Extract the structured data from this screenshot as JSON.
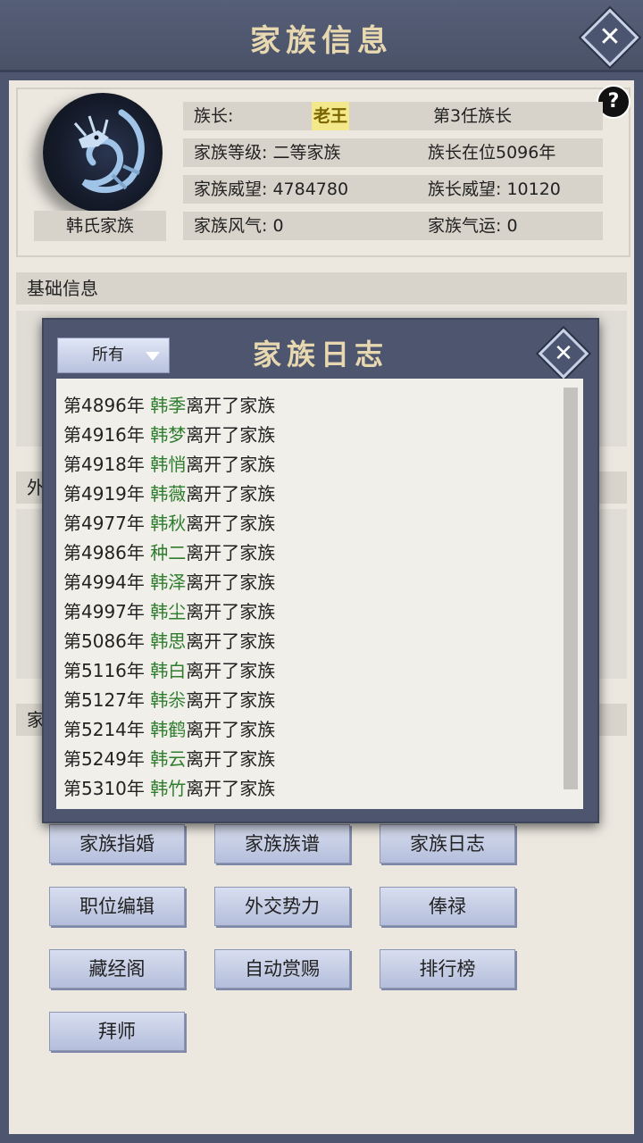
{
  "header": {
    "title": "家族信息",
    "close_label": "✕"
  },
  "clan": {
    "name": "韩氏家族",
    "help_label": "?",
    "leader_label": "族长:",
    "leader_name": "老王",
    "leader_term": "第3任族长",
    "level": "家族等级: 二等家族",
    "leader_years": "族长在位5096年",
    "prestige": "家族威望: 4784780",
    "leader_prestige": "族长威望: 10120",
    "atmosphere": "家族风气: 0",
    "fortune": "家族气运: 0"
  },
  "sections": {
    "basic": "基础信息",
    "foreign": "外",
    "family": "家"
  },
  "buttons": [
    {
      "label": "家族指婚"
    },
    {
      "label": "家族族谱"
    },
    {
      "label": "家族日志"
    },
    {
      "label": "职位编辑"
    },
    {
      "label": "外交势力"
    },
    {
      "label": "俸禄"
    },
    {
      "label": "藏经阁"
    },
    {
      "label": "自动赏赐"
    },
    {
      "label": "排行榜"
    },
    {
      "label": "拜师"
    }
  ],
  "log_modal": {
    "title": "家族日志",
    "filter_value": "所有",
    "close_label": "✕",
    "entries": [
      {
        "year": "第4896年 ",
        "name": "韩季",
        "action": "离开了家族"
      },
      {
        "year": "第4916年 ",
        "name": "韩梦",
        "action": "离开了家族"
      },
      {
        "year": "第4918年 ",
        "name": "韩悄",
        "action": "离开了家族"
      },
      {
        "year": "第4919年 ",
        "name": "韩薇",
        "action": "离开了家族"
      },
      {
        "year": "第4977年 ",
        "name": "韩秋",
        "action": "离开了家族"
      },
      {
        "year": "第4986年 ",
        "name": "种二",
        "action": "离开了家族"
      },
      {
        "year": "第4994年 ",
        "name": "韩泽",
        "action": "离开了家族"
      },
      {
        "year": "第4997年 ",
        "name": "韩尘",
        "action": "离开了家族"
      },
      {
        "year": "第5086年 ",
        "name": "韩思",
        "action": "离开了家族"
      },
      {
        "year": "第5116年 ",
        "name": "韩白",
        "action": "离开了家族"
      },
      {
        "year": "第5127年 ",
        "name": "韩尜",
        "action": "离开了家族"
      },
      {
        "year": "第5214年 ",
        "name": "韩鹤",
        "action": "离开了家族"
      },
      {
        "year": "第5249年 ",
        "name": "韩云",
        "action": "离开了家族"
      },
      {
        "year": "第5310年 ",
        "name": "韩竹",
        "action": "离开了家族"
      }
    ]
  }
}
